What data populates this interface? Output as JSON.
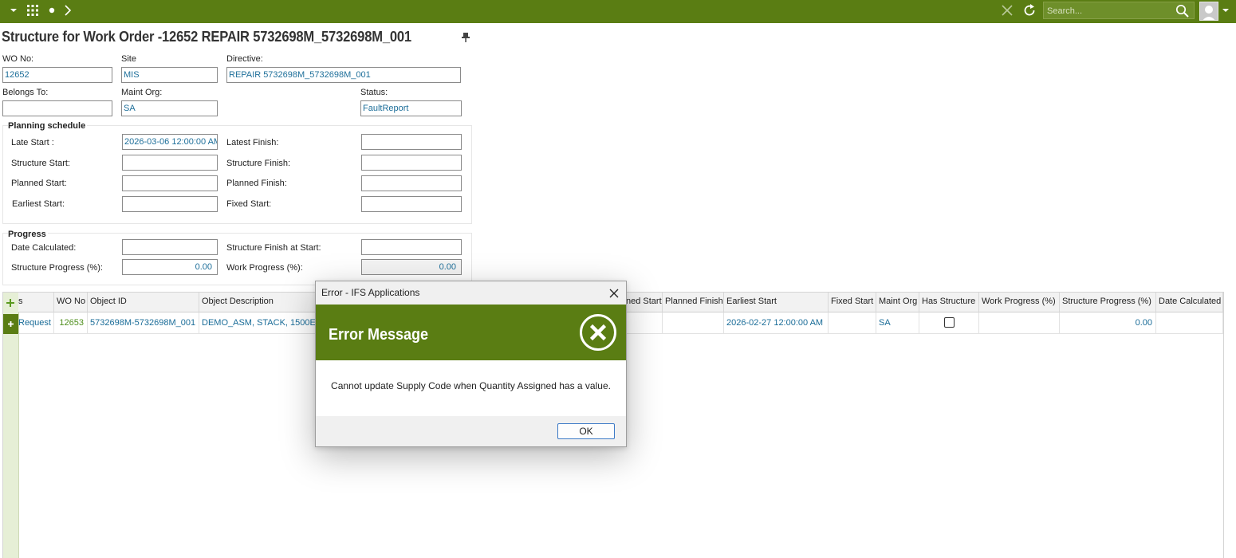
{
  "topbar": {
    "search_placeholder": "Search...",
    "colors": {
      "bar": "#5a7d13"
    }
  },
  "title": "Structure for Work Order -12652 REPAIR 5732698M_5732698M_001",
  "header_fields": {
    "wo_no_label": "WO No:",
    "wo_no": "12652",
    "site_label": "Site",
    "site": "MIS",
    "directive_label": "Directive:",
    "directive": "REPAIR 5732698M_5732698M_001",
    "belongs_to_label": "Belongs To:",
    "belongs_to": "",
    "maint_org_label": "Maint Org:",
    "maint_org": "SA",
    "status_label": "Status:",
    "status": "FaultReport"
  },
  "planning": {
    "title": "Planning schedule",
    "late_start_label": "Late Start :",
    "late_start": "2026-03-06 12:00:00 AM",
    "latest_finish_label": "Latest Finish:",
    "latest_finish": "",
    "structure_start_label": "Structure Start:",
    "structure_start": "",
    "structure_finish_label": "Structure Finish:",
    "structure_finish": "",
    "planned_start_label": "Planned Start:",
    "planned_start": "",
    "planned_finish_label": "Planned Finish:",
    "planned_finish": "",
    "earliest_start_label": "Earliest Start:",
    "earliest_start": "",
    "fixed_start_label": "Fixed Start:",
    "fixed_start": ""
  },
  "progress": {
    "title": "Progress",
    "date_calculated_label": "Date Calculated:",
    "date_calculated": "",
    "structure_finish_at_start_label": "Structure Finish at Start:",
    "structure_finish_at_start": "",
    "structure_progress_label": "Structure Progress (%):",
    "structure_progress": "0.00",
    "work_progress_label": "Work Progress (%):",
    "work_progress": "0.00"
  },
  "grid": {
    "columns": {
      "type": "s",
      "wo_no": "WO No",
      "object_id": "Object ID",
      "object_desc": "Object  Description",
      "planned_start": "ned Start",
      "planned_finish": "Planned Finish",
      "earliest_start": "Earliest Start",
      "fixed_start": "Fixed Start",
      "maint_org": "Maint Org",
      "has_structure": "Has Structure",
      "work_progress": "Work Progress (%)",
      "structure_progress": "Structure Progress (%)",
      "date_calculated": "Date Calculated"
    },
    "row": {
      "type": "Request",
      "wo_no": "12653",
      "object_id": "5732698M-5732698M_001",
      "object_desc": "DEMO_ASM, STACK, 1500E,",
      "planned_start": "",
      "planned_finish": "",
      "earliest_start": "2026-02-27 12:00:00 AM",
      "fixed_start": "",
      "maint_org": "SA",
      "has_structure": false,
      "work_progress": "",
      "structure_progress": "0.00",
      "date_calculated": ""
    }
  },
  "dialog": {
    "window_title": "Error - IFS Applications",
    "heading": "Error Message",
    "message": "Cannot update Supply Code when Quantity Assigned has a value.",
    "ok_label": "OK"
  }
}
